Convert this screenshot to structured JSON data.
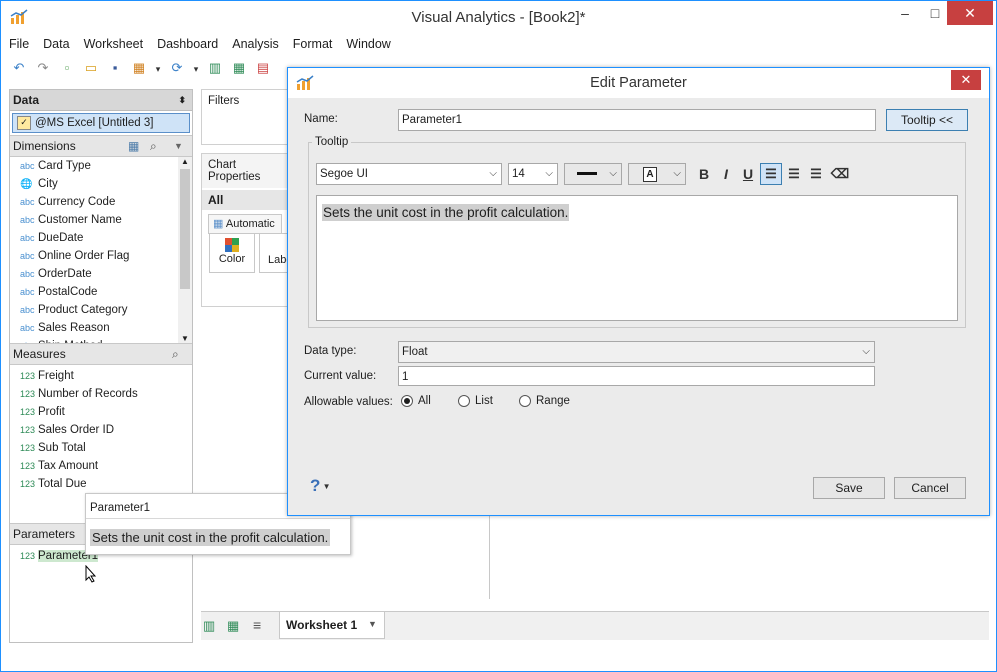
{
  "app": {
    "title": "Visual Analytics - [Book2]*",
    "window_controls": [
      "–",
      "□",
      "✕"
    ]
  },
  "menu": [
    "File",
    "Data",
    "Worksheet",
    "Dashboard",
    "Analysis",
    "Format",
    "Window"
  ],
  "data_panel": {
    "header": "Data",
    "datasource": "@MS Excel [Untitled 3]",
    "dimensions_label": "Dimensions",
    "dimensions": [
      {
        "type": "abc",
        "name": "Card Type"
      },
      {
        "type": "globe",
        "name": "City"
      },
      {
        "type": "abc",
        "name": "Currency Code"
      },
      {
        "type": "abc",
        "name": "Customer Name"
      },
      {
        "type": "abc",
        "name": "DueDate"
      },
      {
        "type": "abc",
        "name": "Online Order Flag"
      },
      {
        "type": "abc",
        "name": "OrderDate"
      },
      {
        "type": "abc",
        "name": "PostalCode"
      },
      {
        "type": "abc",
        "name": "Product Category"
      },
      {
        "type": "abc",
        "name": "Sales Reason"
      },
      {
        "type": "abc",
        "name": "Ship Method"
      }
    ],
    "measures_label": "Measures",
    "measures": [
      {
        "type": "123",
        "name": "Freight"
      },
      {
        "type": "123",
        "name": "Number of Records"
      },
      {
        "type": "123",
        "name": "Profit"
      },
      {
        "type": "123",
        "name": "Sales Order ID"
      },
      {
        "type": "123",
        "name": "Sub Total"
      },
      {
        "type": "123",
        "name": "Tax Amount"
      },
      {
        "type": "123",
        "name": "Total Due"
      }
    ],
    "parameters_label": "Parameters",
    "parameters": [
      {
        "type": "123",
        "name": "Parameter1"
      }
    ]
  },
  "tooltip_popup": {
    "title": "Parameter1",
    "text": "Sets the unit cost in the profit calculation."
  },
  "filters": {
    "label": "Filters"
  },
  "chart_properties": {
    "label": "Chart Properties",
    "all_tab": "All",
    "mark_type": "Automatic",
    "color_label": "Color",
    "label_label": "Label"
  },
  "sheet_tabs": {
    "active": "Worksheet 1"
  },
  "dialog": {
    "title": "Edit Parameter",
    "name_label": "Name:",
    "name_value": "Parameter1",
    "tooltip_button": "Tooltip <<",
    "tooltip_group": "Tooltip",
    "font": "Segoe UI",
    "size": "14",
    "tooltip_text": "Sets the unit cost in the profit calculation.",
    "data_type_label": "Data type:",
    "data_type": "Float",
    "current_value_label": "Current value:",
    "current_value": "1",
    "allowable_label": "Allowable values:",
    "allowable_options": [
      "All",
      "List",
      "Range"
    ],
    "allowable_selected": "All",
    "help_glyph": "?",
    "save": "Save",
    "cancel": "Cancel"
  }
}
